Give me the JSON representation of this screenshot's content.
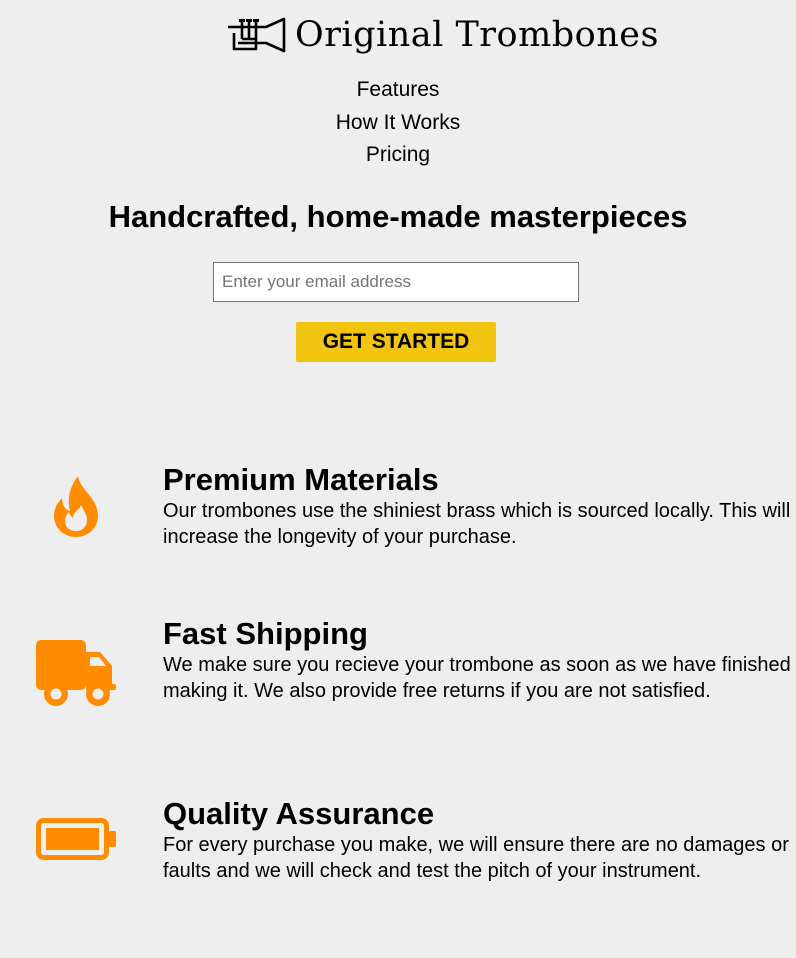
{
  "brand": {
    "name": "Original Trombones",
    "logo_icon": "trumpet-icon"
  },
  "nav": {
    "items": [
      {
        "label": "Features"
      },
      {
        "label": "How It Works"
      },
      {
        "label": "Pricing"
      }
    ]
  },
  "hero": {
    "title": "Handcrafted, home-made masterpieces",
    "email_placeholder": "Enter your email address",
    "email_value": "",
    "cta_label": "GET STARTED"
  },
  "features": [
    {
      "icon": "fire-icon",
      "title": "Premium Materials",
      "description": "Our trombones use the shiniest brass which is sourced locally. This will increase the longevity of your purchase."
    },
    {
      "icon": "truck-icon",
      "title": "Fast Shipping",
      "description": "We make sure you recieve your trombone as soon as we have finished making it. We also provide free returns if you are not satisfied."
    },
    {
      "icon": "battery-full-icon",
      "title": "Quality Assurance",
      "description": "For every purchase you make, we will ensure there are no damages or faults and we will check and test the pitch of your instrument."
    }
  ],
  "colors": {
    "background": "#eeeeee",
    "accent_button": "#f1c40f",
    "icon_orange": "#ff8c00",
    "text": "#000000"
  }
}
